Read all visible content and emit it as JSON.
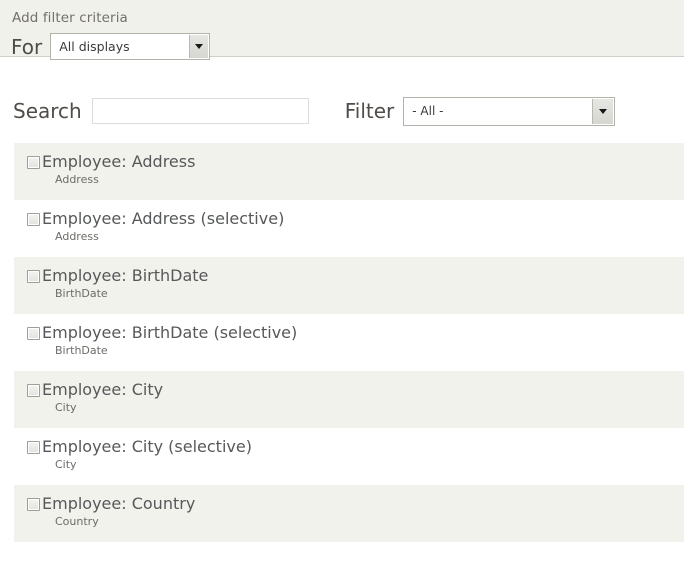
{
  "header": {
    "title": "Add filter criteria",
    "for_label": "For",
    "for_select": {
      "value": "All displays",
      "arrow_icon": "chevron-down-icon"
    }
  },
  "controls": {
    "search_label": "Search",
    "search_value": "",
    "search_placeholder": "",
    "filter_label": "Filter",
    "filter_select": {
      "value": "- All -",
      "arrow_icon": "chevron-down-icon"
    }
  },
  "criteria": {
    "rows": [
      {
        "title": "Employee: Address",
        "description": "Address",
        "checked": false
      },
      {
        "title": "Employee: Address (selective)",
        "description": "Address",
        "checked": false
      },
      {
        "title": "Employee: BirthDate",
        "description": "BirthDate",
        "checked": false
      },
      {
        "title": "Employee: BirthDate (selective)",
        "description": "BirthDate",
        "checked": false
      },
      {
        "title": "Employee: City",
        "description": "City",
        "checked": false
      },
      {
        "title": "Employee: City (selective)",
        "description": "City",
        "checked": false
      },
      {
        "title": "Employee: Country",
        "description": "Country",
        "checked": false
      }
    ]
  },
  "colors": {
    "band_background": "#f1f1ec",
    "row_alt_background": "#f2f2ec",
    "band_border": "#cfcfc8",
    "title_text": "#73706b",
    "row_title_text": "#56585a",
    "row_desc_text": "#6c6c68"
  }
}
